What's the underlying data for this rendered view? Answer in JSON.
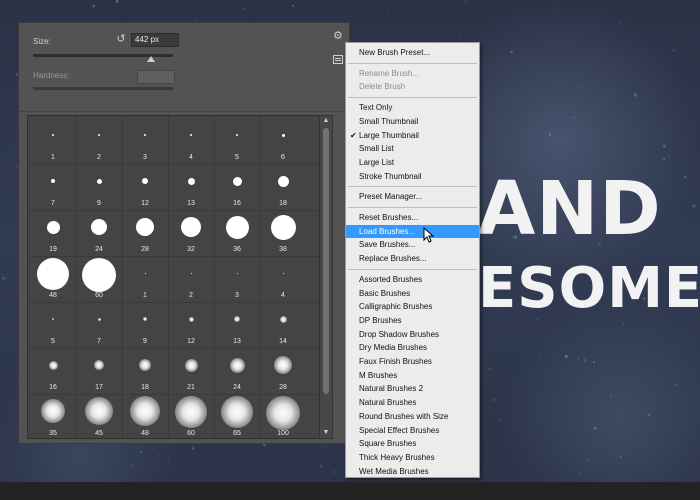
{
  "background_text": {
    "line1": "AND",
    "line2": "ESOME"
  },
  "brush_panel": {
    "size_label": "Size:",
    "size_value": "442 px",
    "hardness_label": "Hardness:",
    "size_slider_fraction": 0.84,
    "brushes": [
      {
        "label": "1",
        "d": 2
      },
      {
        "label": "2",
        "d": 2
      },
      {
        "label": "3",
        "d": 2
      },
      {
        "label": "4",
        "d": 2
      },
      {
        "label": "5",
        "d": 2
      },
      {
        "label": "6",
        "d": 3
      },
      {
        "label": "7",
        "d": 4
      },
      {
        "label": "9",
        "d": 5
      },
      {
        "label": "12",
        "d": 6
      },
      {
        "label": "13",
        "d": 7
      },
      {
        "label": "16",
        "d": 9
      },
      {
        "label": "18",
        "d": 11
      },
      {
        "label": "19",
        "d": 13
      },
      {
        "label": "24",
        "d": 16
      },
      {
        "label": "28",
        "d": 18
      },
      {
        "label": "32",
        "d": 20
      },
      {
        "label": "36",
        "d": 23
      },
      {
        "label": "38",
        "d": 25
      },
      {
        "label": "48",
        "d": 32
      },
      {
        "label": "60",
        "d": 34
      },
      {
        "label": "1",
        "d": 1
      },
      {
        "label": "2",
        "d": 1
      },
      {
        "label": "3",
        "d": 1
      },
      {
        "label": "4",
        "d": 1
      },
      {
        "label": "5",
        "d": 2,
        "soft": true
      },
      {
        "label": "7",
        "d": 3,
        "soft": true
      },
      {
        "label": "9",
        "d": 4,
        "soft": true
      },
      {
        "label": "12",
        "d": 5,
        "soft": true
      },
      {
        "label": "13",
        "d": 6,
        "soft": true
      },
      {
        "label": "14",
        "d": 7,
        "soft": true
      },
      {
        "label": "16",
        "d": 9,
        "soft": true
      },
      {
        "label": "17",
        "d": 10,
        "soft": true
      },
      {
        "label": "18",
        "d": 12,
        "soft": true
      },
      {
        "label": "21",
        "d": 13,
        "soft": true
      },
      {
        "label": "24",
        "d": 15,
        "soft": true
      },
      {
        "label": "28",
        "d": 18,
        "soft": true
      },
      {
        "label": "35",
        "d": 24,
        "soft": true
      },
      {
        "label": "45",
        "d": 28,
        "soft": true
      },
      {
        "label": "48",
        "d": 30,
        "soft": true
      },
      {
        "label": "60",
        "d": 32,
        "soft": true
      },
      {
        "label": "65",
        "d": 32,
        "soft": true
      },
      {
        "label": "100",
        "d": 34,
        "soft": true
      }
    ]
  },
  "menu": {
    "items": [
      {
        "label": "New Brush Preset...",
        "state": "normal"
      },
      {
        "sep": true
      },
      {
        "label": "Rename Brush...",
        "state": "disabled"
      },
      {
        "label": "Delete Brush",
        "state": "disabled"
      },
      {
        "sep": true
      },
      {
        "label": "Text Only",
        "state": "normal"
      },
      {
        "label": "Small Thumbnail",
        "state": "normal"
      },
      {
        "label": "Large Thumbnail",
        "state": "checked"
      },
      {
        "label": "Small List",
        "state": "normal"
      },
      {
        "label": "Large List",
        "state": "normal"
      },
      {
        "label": "Stroke Thumbnail",
        "state": "normal"
      },
      {
        "sep": true
      },
      {
        "label": "Preset Manager...",
        "state": "normal"
      },
      {
        "sep": true
      },
      {
        "label": "Reset Brushes...",
        "state": "normal"
      },
      {
        "label": "Load Brushes...",
        "state": "highlight"
      },
      {
        "label": "Save Brushes...",
        "state": "normal"
      },
      {
        "label": "Replace Brushes...",
        "state": "normal"
      },
      {
        "sep": true
      },
      {
        "label": "Assorted Brushes",
        "state": "normal"
      },
      {
        "label": "Basic Brushes",
        "state": "normal"
      },
      {
        "label": "Calligraphic Brushes",
        "state": "normal"
      },
      {
        "label": "DP Brushes",
        "state": "normal"
      },
      {
        "label": "Drop Shadow Brushes",
        "state": "normal"
      },
      {
        "label": "Dry Media Brushes",
        "state": "normal"
      },
      {
        "label": "Faux Finish Brushes",
        "state": "normal"
      },
      {
        "label": "M Brushes",
        "state": "normal"
      },
      {
        "label": "Natural Brushes 2",
        "state": "normal"
      },
      {
        "label": "Natural Brushes",
        "state": "normal"
      },
      {
        "label": "Round Brushes with Size",
        "state": "normal"
      },
      {
        "label": "Special Effect Brushes",
        "state": "normal"
      },
      {
        "label": "Square Brushes",
        "state": "normal"
      },
      {
        "label": "Thick Heavy Brushes",
        "state": "normal"
      },
      {
        "label": "Wet Media Brushes",
        "state": "normal"
      }
    ]
  },
  "colors": {
    "menu_highlight": "#3399ff",
    "panel": "#535353"
  }
}
